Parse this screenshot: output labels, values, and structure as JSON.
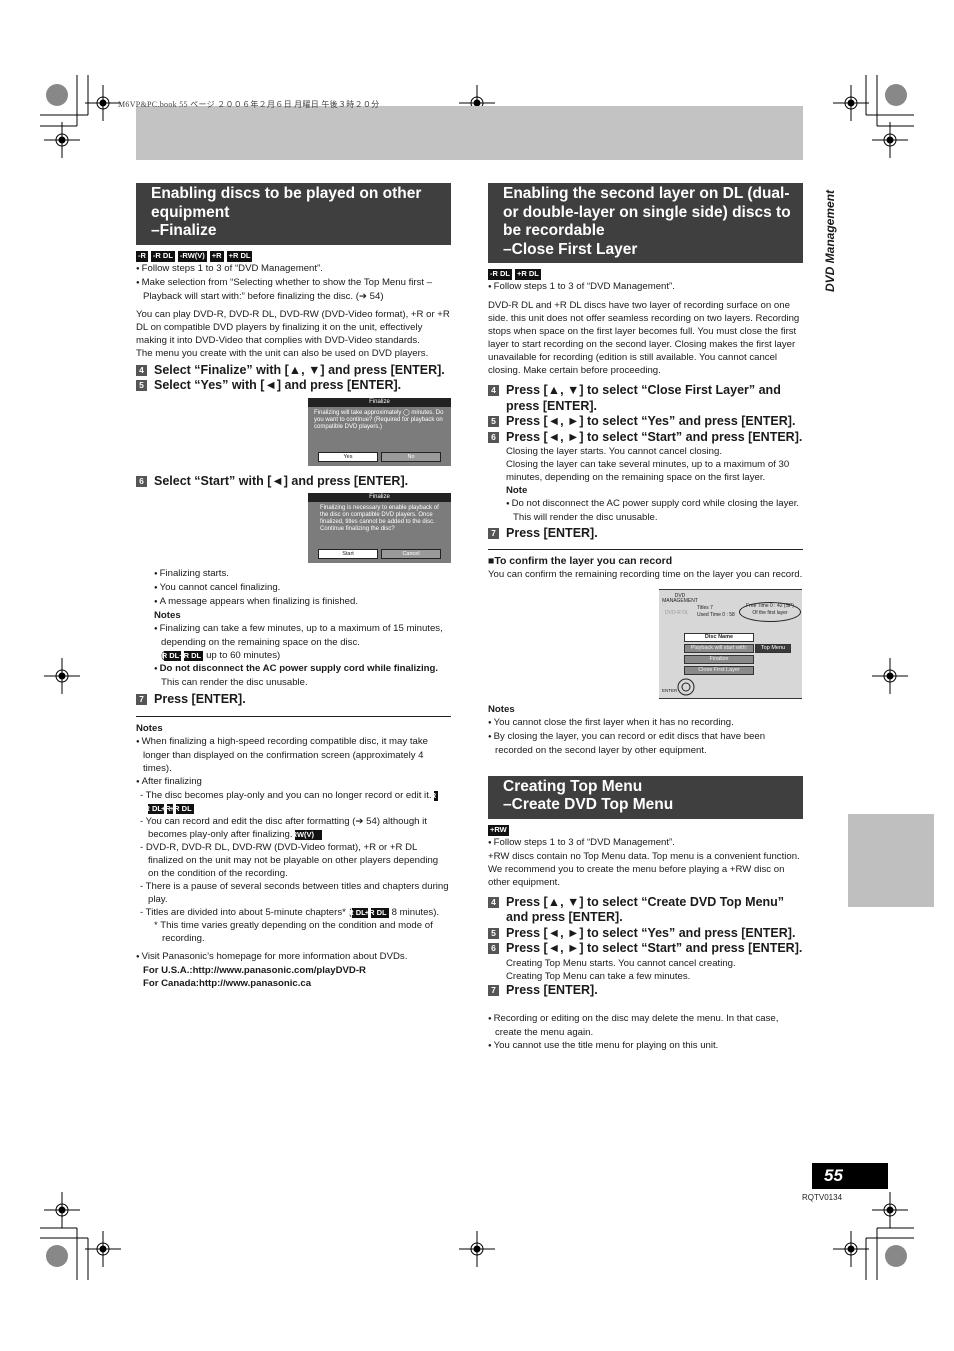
{
  "print_meta": "M6VP&PC.book  55 ページ  ２００６年２月６日  月曜日  午後３時２０分",
  "section_tab": "DVD Management",
  "page_number": "55",
  "doc_code": "RQTV0134",
  "finalize": {
    "heading": [
      "Enabling discs to be played on other",
      "equipment",
      "–Finalize"
    ],
    "badges": [
      "-R",
      "-R DL",
      "-RW(V)",
      "+R",
      "+R DL"
    ],
    "bullets": [
      "Follow steps 1 to 3 of “DVD Management”.",
      "Make selection from “Selecting whether to show the Top Menu first –Playback will start with:” before finalizing the disc. (➔ 54)"
    ],
    "intro": "You can play DVD-R, DVD-R DL, DVD-RW (DVD-Video format), +R or +R DL on compatible DVD players by finalizing it on the unit, effectively making it into DVD-Video that complies with DVD-Video standards.",
    "intro2": "The menu you create with the unit can also be used on DVD players.",
    "steps": [
      {
        "num": "4",
        "text": "Select “Finalize” with [▲, ▼] and press [ENTER]."
      },
      {
        "num": "5",
        "text": "Select “Yes” with [◄] and press [ENTER]."
      },
      {
        "num": "6",
        "text": "Select “Start” with [◄] and press [ENTER]."
      },
      {
        "num": "7",
        "text": "Press [ENTER]."
      }
    ],
    "dialog1": {
      "title": "Finalize",
      "message": "Finalizing will take approximately ◯ minutes. Do you want to continue? (Required for playback on compatible DVD players.)",
      "yes": "Yes",
      "no": "No"
    },
    "dialog2": {
      "title": "Finalize",
      "message": "Finalizing is necessary to enable playback of the disc on compatible DVD players. Once finalized, titles cannot be added to the disc. Continue finalizing the disc?",
      "start": "Start",
      "cancel": "Cancel"
    },
    "after_step6": [
      "Finalizing starts.",
      "You cannot cancel finalizing.",
      "A message appears when finalizing is finished."
    ],
    "notes_title": "Notes",
    "step_notes_1a": "Finalizing can take a few minutes, up to a maximum of 15 minutes, depending on the remaining space on the disc.",
    "step_notes_1_badges": [
      "-R DL",
      "+R DL"
    ],
    "step_notes_1b": "up to 60 minutes)",
    "step_notes_2_bold": "Do not disconnect the AC power supply cord while finalizing.",
    "step_notes_2_rest": " This can render the disc unusable.",
    "notes": {
      "title": "Notes",
      "n1": "When finalizing a high-speed recording compatible disc, it may take longer than displayed on the confirmation screen (approximately 4 times).",
      "n2": "After finalizing",
      "d1": "- The disc becomes play-only and you can no longer record or edit it.",
      "d1_badges": [
        "-R",
        "-R DL",
        "+R",
        "+R DL"
      ],
      "d2": "- You can record and edit the disc after formatting (➔ 54) although it becomes play-only after finalizing.",
      "d2_badge": "-RW(V)",
      "d3": "- DVD-R, DVD-R DL, DVD-RW (DVD-Video format), +R or +R DL finalized on the unit may not be playable on other players depending on the condition of the recording.",
      "d4": "- There is a pause of several seconds between titles and chapters during play.",
      "d5a": "- Titles are divided into about 5-minute chapters* (",
      "d5_badges": [
        "-R DL",
        "+R DL"
      ],
      "d5b": "8 minutes).",
      "star": "* This time varies greatly depending on the condition and mode of recording.",
      "n3": "Visit Panasonic’s homepage for more information about DVDs.",
      "url_usa": "For U.S.A.:http://www.panasonic.com/playDVD-R",
      "url_canada": "For Canada:http://www.panasonic.ca"
    }
  },
  "close_layer": {
    "heading": [
      "Enabling the second layer on DL (dual-",
      "or double-layer on single side) discs to",
      "be recordable",
      "–Close First Layer"
    ],
    "badges": [
      "-R DL",
      "+R DL"
    ],
    "bullet": "Follow steps 1 to 3 of “DVD Management”.",
    "intro": "DVD-R DL and +R DL discs have two layer of recording surface on one side. this unit does not offer seamless recording on two layers. Recording stops when space on the first layer becomes full. You must close the first layer to start recording on the second layer. Closing makes the first layer unavailable for recording (edition is still available. You cannot cancel closing. Make certain before proceeding.",
    "steps": [
      {
        "num": "4",
        "text": "Press [▲, ▼] to select “Close First Layer” and press [ENTER]."
      },
      {
        "num": "5",
        "text": "Press [◄, ►] to select “Yes” and press [ENTER]."
      },
      {
        "num": "6",
        "text": "Press [◄, ►] to select “Start” and press [ENTER]."
      },
      {
        "num": "7",
        "text": "Press [ENTER]."
      }
    ],
    "after_step6_1": "Closing the layer starts. You cannot cancel closing.",
    "after_step6_2": "Closing the layer can take several minutes, up to a maximum of 30 minutes, depending on the remaining space on the first layer.",
    "note_title": "Note",
    "note": "Do not disconnect the AC power supply cord while closing the layer. This will render the disc unusable.",
    "confirm_title": "To confirm the layer you can record",
    "confirm_text": "You can confirm the remaining recording time on the layer you can record.",
    "screen": {
      "header": "DVD MANAGEMENT",
      "disc": "DVD-R DL",
      "titles_label": "Titles",
      "titles_value": "7",
      "used_label": "Used Time",
      "used_value": "0 : 58",
      "free_label": "Free Time",
      "free_value": "0 : 42 (SP)",
      "layer_label": "Of the first layer",
      "menu": [
        "Disc Name",
        "Playback will start with:",
        "Finalize",
        "Close First Layer"
      ],
      "playback_value": "Top Menu",
      "enter_label": "ENTER"
    },
    "notes_title": "Notes",
    "notes": [
      "You cannot close the first layer when it has no recording.",
      "By closing the layer, you can record or edit discs that have been recorded on the second layer by other equipment."
    ]
  },
  "top_menu": {
    "heading": [
      "Creating Top Menu",
      "–Create DVD Top Menu"
    ],
    "badge": "+RW",
    "bullet": "Follow steps 1 to 3 of “DVD Management”.",
    "intro": "+RW discs contain no Top Menu data. Top menu is a convenient function. We recommend you to create the menu before playing a +RW disc on other equipment.",
    "steps": [
      {
        "num": "4",
        "text": "Press [▲, ▼] to select “Create DVD Top Menu” and press [ENTER]."
      },
      {
        "num": "5",
        "text": "Press [◄, ►] to select “Yes” and press [ENTER]."
      },
      {
        "num": "6",
        "text": "Press [◄, ►] to select “Start” and press [ENTER]."
      },
      {
        "num": "7",
        "text": "Press [ENTER]."
      }
    ],
    "after_step6_1": "Creating Top Menu starts. You cannot cancel creating.",
    "after_step6_2": "Creating Top Menu can take a few minutes.",
    "footer_notes": [
      "Recording or editing on the disc may delete the menu. In that case, create the menu again.",
      "You cannot use the title menu for playing on this unit."
    ]
  }
}
